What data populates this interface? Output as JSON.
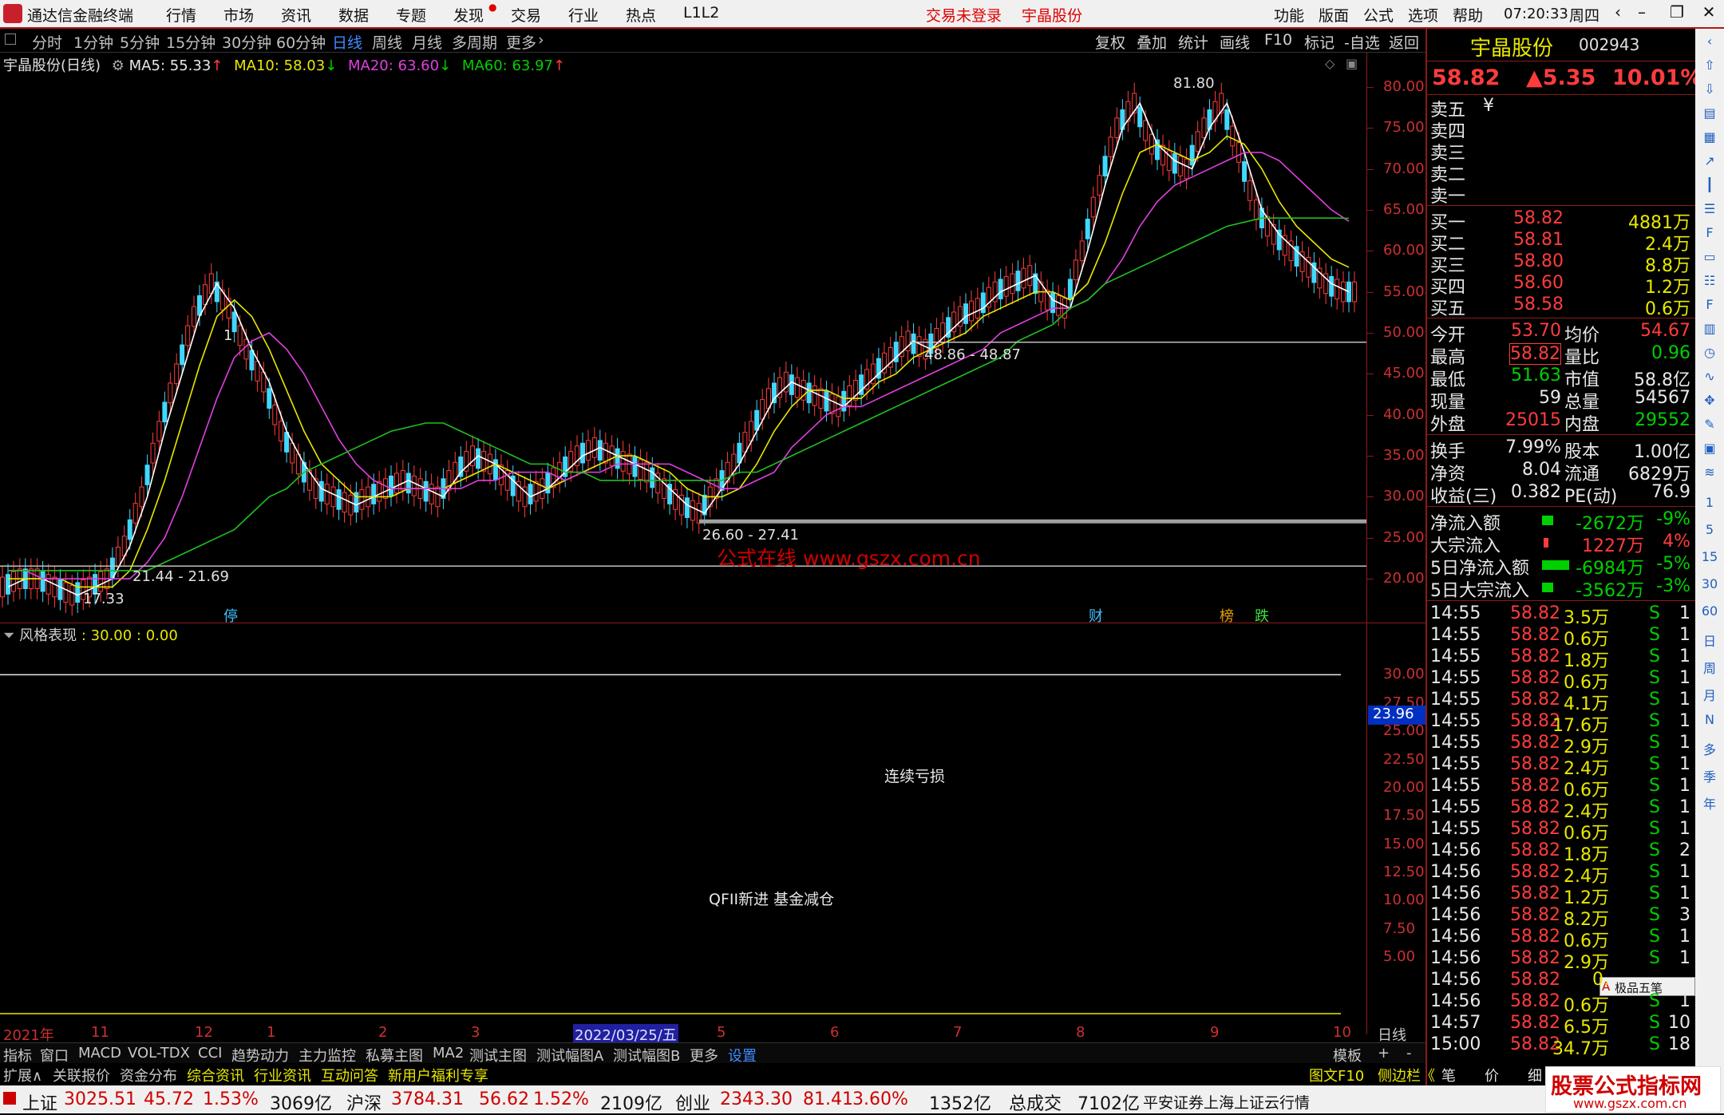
{
  "titlebar": {
    "app_name": "通达信金融终端",
    "menus": [
      "行情",
      "市场",
      "资讯",
      "数据",
      "专题",
      "发现",
      "交易",
      "行业",
      "热点",
      "L1L2"
    ],
    "status_red": "交易未登录",
    "stock_name": "宇晶股份",
    "right_menus": [
      "功能",
      "版面",
      "公式",
      "选项",
      "帮助"
    ],
    "time": "07:20:33",
    "weekday": "周四"
  },
  "periodbar": {
    "items": [
      "分时",
      "1分钟",
      "5分钟",
      "15分钟",
      "30分钟",
      "60分钟",
      "日线",
      "周线",
      "月线",
      "多周期",
      "更多"
    ],
    "active": "日线",
    "right_items": [
      "复权",
      "叠加",
      "统计",
      "画线",
      "F10",
      "标记",
      "-自选",
      "返回"
    ]
  },
  "main_chart": {
    "title": "宇晶股份(日线)",
    "ma5": "MA5: 55.33",
    "ma10": "MA10: 58.03",
    "ma20": "MA20: 63.60",
    "ma60": "MA60: 63.97",
    "annotations": {
      "high": "81.80",
      "low": "17.33",
      "range1": "21.44 - 21.69",
      "range2": "26.60 - 27.41",
      "range3": "48.86 - 48.87",
      "watermark": "公式在线 www.gszx.com.cn",
      "marker1": "1",
      "tag_ting": "停",
      "tag_cai": "财",
      "tag_bang": "榜",
      "tag_die": "跌"
    }
  },
  "chart_data": {
    "type": "line",
    "title": "宇晶股份(日线)",
    "ylim": [
      17,
      83
    ],
    "yticks": [
      "80.00",
      "75.00",
      "70.00",
      "65.00",
      "60.00",
      "55.00",
      "50.00",
      "45.00",
      "40.00",
      "35.00",
      "30.00",
      "25.00",
      "20.00"
    ],
    "x_labels": [
      "2021年",
      "11",
      "12",
      "1",
      "2",
      "3",
      "2022/03/25/五",
      "5",
      "6",
      "7",
      "8",
      "9",
      "10"
    ],
    "series": [
      {
        "name": "MA5",
        "color": "#ffffff",
        "values": [
          19,
          20,
          20,
          19,
          18,
          19,
          20,
          24,
          30,
          38,
          45,
          52,
          56,
          53,
          48,
          44,
          38,
          34,
          31,
          30,
          29,
          30,
          31,
          32,
          31,
          30,
          33,
          35,
          34,
          32,
          30,
          31,
          33,
          35,
          36,
          35,
          34,
          33,
          31,
          29,
          28,
          31,
          34,
          38,
          42,
          44,
          43,
          42,
          41,
          43,
          45,
          47,
          49,
          48,
          50,
          52,
          53,
          55,
          56,
          57,
          54,
          53,
          60,
          68,
          75,
          78,
          73,
          71,
          70,
          75,
          78,
          72,
          65,
          62,
          60,
          58,
          56,
          55
        ]
      },
      {
        "name": "MA10",
        "color": "#e8e800",
        "values": [
          20,
          20,
          20,
          20,
          19,
          19,
          19,
          21,
          26,
          32,
          39,
          46,
          52,
          54,
          52,
          48,
          43,
          38,
          34,
          32,
          30,
          30,
          30,
          31,
          31,
          31,
          32,
          33,
          34,
          33,
          32,
          31,
          32,
          33,
          34,
          35,
          35,
          34,
          33,
          31,
          30,
          30,
          31,
          34,
          38,
          41,
          43,
          43,
          42,
          42,
          44,
          45,
          47,
          48,
          49,
          50,
          52,
          53,
          54,
          55,
          55,
          54,
          56,
          61,
          67,
          72,
          73,
          72,
          71,
          72,
          74,
          73,
          70,
          66,
          63,
          61,
          59,
          58
        ]
      },
      {
        "name": "MA20",
        "color": "#e040e0",
        "values": [
          21,
          21,
          20,
          20,
          20,
          20,
          20,
          20,
          22,
          25,
          30,
          36,
          42,
          47,
          49,
          50,
          48,
          45,
          41,
          37,
          34,
          32,
          31,
          31,
          31,
          31,
          31,
          32,
          32,
          33,
          33,
          33,
          32,
          33,
          33,
          34,
          34,
          34,
          34,
          33,
          32,
          31,
          31,
          32,
          33,
          36,
          38,
          40,
          41,
          41,
          42,
          43,
          44,
          45,
          46,
          47,
          48,
          50,
          51,
          52,
          53,
          53,
          54,
          56,
          59,
          63,
          66,
          68,
          69,
          70,
          71,
          72,
          72,
          71,
          69,
          67,
          65,
          63.6
        ]
      },
      {
        "name": "MA60",
        "color": "#20c020",
        "values": [
          21,
          21,
          21,
          21,
          21,
          21,
          21,
          21,
          21,
          22,
          23,
          24,
          25,
          26,
          28,
          30,
          31,
          33,
          34,
          35,
          36,
          37,
          38,
          38.5,
          39,
          39,
          38,
          37,
          36,
          35,
          34,
          34,
          33,
          33,
          32,
          32,
          32,
          32,
          32,
          32,
          32,
          32,
          33,
          33,
          34,
          35,
          36,
          37,
          38,
          39,
          40,
          41,
          42,
          43,
          44,
          45,
          46,
          47,
          49,
          50,
          51,
          53,
          54,
          56,
          57,
          58,
          59,
          60,
          61,
          62,
          63,
          63.5,
          64,
          64,
          64,
          64,
          64,
          63.97
        ]
      }
    ]
  },
  "sub_chart": {
    "title": "风格表现",
    "params": ": 30.00 : 0.00",
    "yticks": [
      "30.00",
      "27.50",
      "25.00",
      "22.50",
      "20.00",
      "17.50",
      "15.00",
      "12.50",
      "10.00",
      "7.50",
      "5.00"
    ],
    "current": "23.96",
    "label1": "连续亏损",
    "label2": "QFII新进 基金减仓",
    "axis_right": "日线"
  },
  "bottom_tabs": [
    "指标",
    "窗口",
    "MACD",
    "VOL-TDX",
    "CCI",
    "趋势动力",
    "主力监控",
    "私募主图",
    "MA2",
    "测试主图",
    "测试幅图A",
    "测试幅图B",
    "更多",
    "设置"
  ],
  "bottom_right": [
    "模板",
    "+",
    "-"
  ],
  "bottom_tabs2": [
    "扩展∧",
    "关联报价",
    "资金分布",
    "综合资讯",
    "行业资讯",
    "互动问答",
    "新用户福利专享"
  ],
  "bottom_tabs2_right": [
    "图文F10",
    "侧边栏《",
    "笔",
    "价",
    "细",
    "势"
  ],
  "quote": {
    "name": "宇晶股份",
    "code": "002943",
    "price": "58.82",
    "change": "▲5.35",
    "pct": "10.01%",
    "sell": [
      "卖五",
      "卖四",
      "卖三",
      "卖二",
      "卖一"
    ],
    "sell5_extra": "¥",
    "buy": [
      {
        "label": "买一",
        "price": "58.82",
        "vol": "4881万"
      },
      {
        "label": "买二",
        "price": "58.81",
        "vol": "2.4万"
      },
      {
        "label": "买三",
        "price": "58.80",
        "vol": "8.8万"
      },
      {
        "label": "买四",
        "price": "58.60",
        "vol": "1.2万"
      },
      {
        "label": "买五",
        "price": "58.58",
        "vol": "0.6万"
      }
    ],
    "stats": [
      {
        "l1": "今开",
        "v1": "53.70",
        "l2": "均价",
        "v2": "54.67"
      },
      {
        "l1": "最高",
        "v1": "58.82",
        "l2": "量比",
        "v2": "0.96"
      },
      {
        "l1": "最低",
        "v1": "51.63",
        "l2": "市值",
        "v2": "58.8亿"
      },
      {
        "l1": "现量",
        "v1": "59",
        "l2": "总量",
        "v2": "54567"
      },
      {
        "l1": "外盘",
        "v1": "25015",
        "l2": "内盘",
        "v2": "29552"
      }
    ],
    "stats2": [
      {
        "l1": "换手",
        "v1": "7.99%",
        "l2": "股本",
        "v2": "1.00亿"
      },
      {
        "l1": "净资",
        "v1": "8.04",
        "l2": "流通",
        "v2": "6829万"
      },
      {
        "l1": "收益(三)",
        "v1": "0.382",
        "l2": "PE(动)",
        "v2": "76.9"
      }
    ],
    "flows": [
      {
        "label": "净流入额",
        "val": "-2672万",
        "pct": "-9%"
      },
      {
        "label": "大宗流入",
        "val": "1227万",
        "pct": "4%"
      },
      {
        "label": "5日净流入额",
        "val": "-6984万",
        "pct": "-5%"
      },
      {
        "label": "5日大宗流入",
        "val": "-3562万",
        "pct": "-3%"
      }
    ],
    "ticks": [
      {
        "t": "14:55",
        "p": "58.82",
        "v": "3.5万",
        "s": "S",
        "n": "1"
      },
      {
        "t": "14:55",
        "p": "58.82",
        "v": "0.6万",
        "s": "S",
        "n": "1"
      },
      {
        "t": "14:55",
        "p": "58.82",
        "v": "1.8万",
        "s": "S",
        "n": "1"
      },
      {
        "t": "14:55",
        "p": "58.82",
        "v": "0.6万",
        "s": "S",
        "n": "1"
      },
      {
        "t": "14:55",
        "p": "58.82",
        "v": "4.1万",
        "s": "S",
        "n": "1"
      },
      {
        "t": "14:55",
        "p": "58.82",
        "v": "17.6万",
        "s": "S",
        "n": "1"
      },
      {
        "t": "14:55",
        "p": "58.82",
        "v": "2.9万",
        "s": "S",
        "n": "1"
      },
      {
        "t": "14:55",
        "p": "58.82",
        "v": "2.4万",
        "s": "S",
        "n": "1"
      },
      {
        "t": "14:55",
        "p": "58.82",
        "v": "0.6万",
        "s": "S",
        "n": "1"
      },
      {
        "t": "14:55",
        "p": "58.82",
        "v": "2.4万",
        "s": "S",
        "n": "1"
      },
      {
        "t": "14:55",
        "p": "58.82",
        "v": "0.6万",
        "s": "S",
        "n": "1"
      },
      {
        "t": "14:56",
        "p": "58.82",
        "v": "1.8万",
        "s": "S",
        "n": "2"
      },
      {
        "t": "14:56",
        "p": "58.82",
        "v": "2.4万",
        "s": "S",
        "n": "1"
      },
      {
        "t": "14:56",
        "p": "58.82",
        "v": "1.2万",
        "s": "S",
        "n": "1"
      },
      {
        "t": "14:56",
        "p": "58.82",
        "v": "8.2万",
        "s": "S",
        "n": "3"
      },
      {
        "t": "14:56",
        "p": "58.82",
        "v": "0.6万",
        "s": "S",
        "n": "1"
      },
      {
        "t": "14:56",
        "p": "58.82",
        "v": "2.9万",
        "s": "S",
        "n": "1"
      },
      {
        "t": "14:56",
        "p": "58.82",
        "v": "0.",
        "s": "",
        "n": ""
      },
      {
        "t": "14:56",
        "p": "58.82",
        "v": "0.6万",
        "s": "S",
        "n": "1"
      },
      {
        "t": "14:57",
        "p": "58.82",
        "v": "6.5万",
        "s": "S",
        "n": "10"
      },
      {
        "t": "15:00",
        "p": "58.82",
        "v": "34.7万",
        "s": "S",
        "n": "18"
      }
    ],
    "ime": "极品五笔"
  },
  "sidebar_labels": [
    "1",
    "5",
    "15",
    "30",
    "60",
    "日",
    "周",
    "月",
    "N",
    "多",
    "季",
    "年"
  ],
  "statusbar": {
    "items": [
      {
        "name": "上证",
        "price": "3025.51",
        "chg": "45.72",
        "pct": "1.53%",
        "amt": "3069亿"
      },
      {
        "name": "沪深",
        "price": "3784.31",
        "chg": "56.62",
        "pct": "1.52%",
        "amt": "2109亿"
      },
      {
        "name": "创业",
        "price": "2343.30",
        "chg": "81.41",
        "pct": "3.60%",
        "amt": "1352亿"
      }
    ],
    "total_label": "总成交",
    "total": "7102亿",
    "broker": "平安证券上海上证云行情",
    "logo_top": "股票公式指标网",
    "logo_bottom": "www.gszx.com.cn"
  }
}
